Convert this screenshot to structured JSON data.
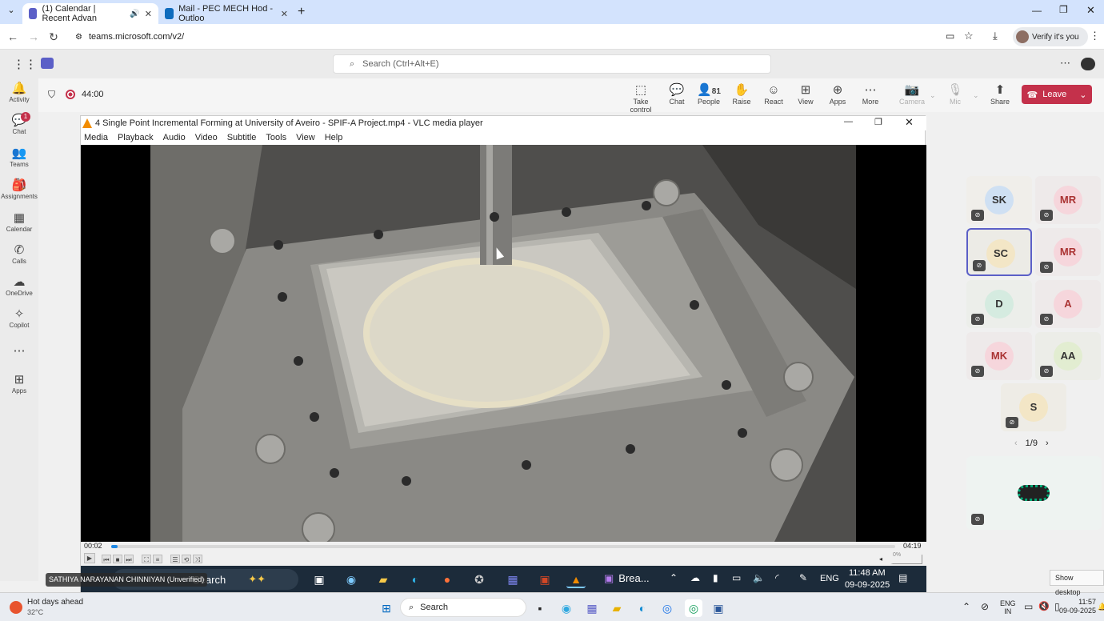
{
  "browser": {
    "tabs": [
      {
        "label": "(1) Calendar | Recent Advan"
      },
      {
        "label": "Mail - PEC MECH Hod - Outloo"
      }
    ],
    "url": "teams.microsoft.com/v2/",
    "verify_label": "Verify it's you"
  },
  "teams": {
    "search_placeholder": "Search (Ctrl+Alt+E)",
    "rail": [
      {
        "label": "Activity",
        "icon": "bell-icon"
      },
      {
        "label": "Chat",
        "icon": "chat-icon",
        "badge": "1"
      },
      {
        "label": "Teams",
        "icon": "teams-icon"
      },
      {
        "label": "Assignments",
        "icon": "assignments-icon"
      },
      {
        "label": "Calendar",
        "icon": "calendar-icon"
      },
      {
        "label": "Calls",
        "icon": "phone-icon"
      },
      {
        "label": "OneDrive",
        "icon": "cloud-icon"
      },
      {
        "label": "Copilot",
        "icon": "copilot-icon"
      },
      {
        "label": "",
        "icon": "more-icon"
      },
      {
        "label": "Apps",
        "icon": "apps-icon"
      }
    ],
    "timer": "44:00",
    "toolbar": [
      {
        "label": "Take control",
        "icon": "take-control-icon"
      },
      {
        "label": "Chat",
        "icon": "chat-icon"
      },
      {
        "label": "People",
        "icon": "people-icon",
        "count": "81"
      },
      {
        "label": "Raise",
        "icon": "hand-icon"
      },
      {
        "label": "React",
        "icon": "smiley-icon"
      },
      {
        "label": "View",
        "icon": "grid-icon"
      },
      {
        "label": "Apps",
        "icon": "plus-icon"
      },
      {
        "label": "More",
        "icon": "ellipsis-icon"
      },
      {
        "label": "Camera",
        "icon": "camera-off-icon",
        "disabled": true
      },
      {
        "label": "Mic",
        "icon": "mic-off-icon",
        "disabled": true
      },
      {
        "label": "Share",
        "icon": "share-icon"
      }
    ],
    "leave_label": "Leave"
  },
  "vlc": {
    "title": "4 Single Point Incremental Forming at University of Aveiro - SPIF-A Project.mp4 - VLC media player",
    "menu": [
      "Media",
      "Playback",
      "Audio",
      "Video",
      "Subtitle",
      "Tools",
      "View",
      "Help"
    ],
    "elapsed": "00:02",
    "duration": "04:19",
    "progress_fraction": 0.008,
    "volume": "0%"
  },
  "remote_taskbar": {
    "search": "Search",
    "brea": "Brea...",
    "lang": "ENG",
    "time": "11:48 AM",
    "date": "09-09-2025"
  },
  "presenter_label": "SATHIYA NARAYANAN CHINNIYAN (Unverified)",
  "participants": [
    {
      "initials": "SK",
      "color": "#cfe0f3"
    },
    {
      "initials": "MR",
      "color": "#f6d6dc"
    },
    {
      "initials": "SC",
      "color": "#f3e6c6",
      "active": true
    },
    {
      "initials": "MR",
      "color": "#f6d6dc"
    },
    {
      "initials": "D",
      "color": "#d5ebe0"
    },
    {
      "initials": "A",
      "color": "#f6d6dc"
    },
    {
      "initials": "MK",
      "color": "#f6d6dc"
    },
    {
      "initials": "AA",
      "color": "#e2edd1"
    },
    {
      "initials": "S",
      "color": "#f3e6c6"
    }
  ],
  "pager": "1/9",
  "os_taskbar": {
    "weather_title": "Hot days ahead",
    "weather_temp": "32°C",
    "search": "Search",
    "lang_line1": "ENG",
    "lang_line2": "IN",
    "time": "11:57",
    "date": "09-09-2025",
    "show_desktop": "Show desktop"
  }
}
